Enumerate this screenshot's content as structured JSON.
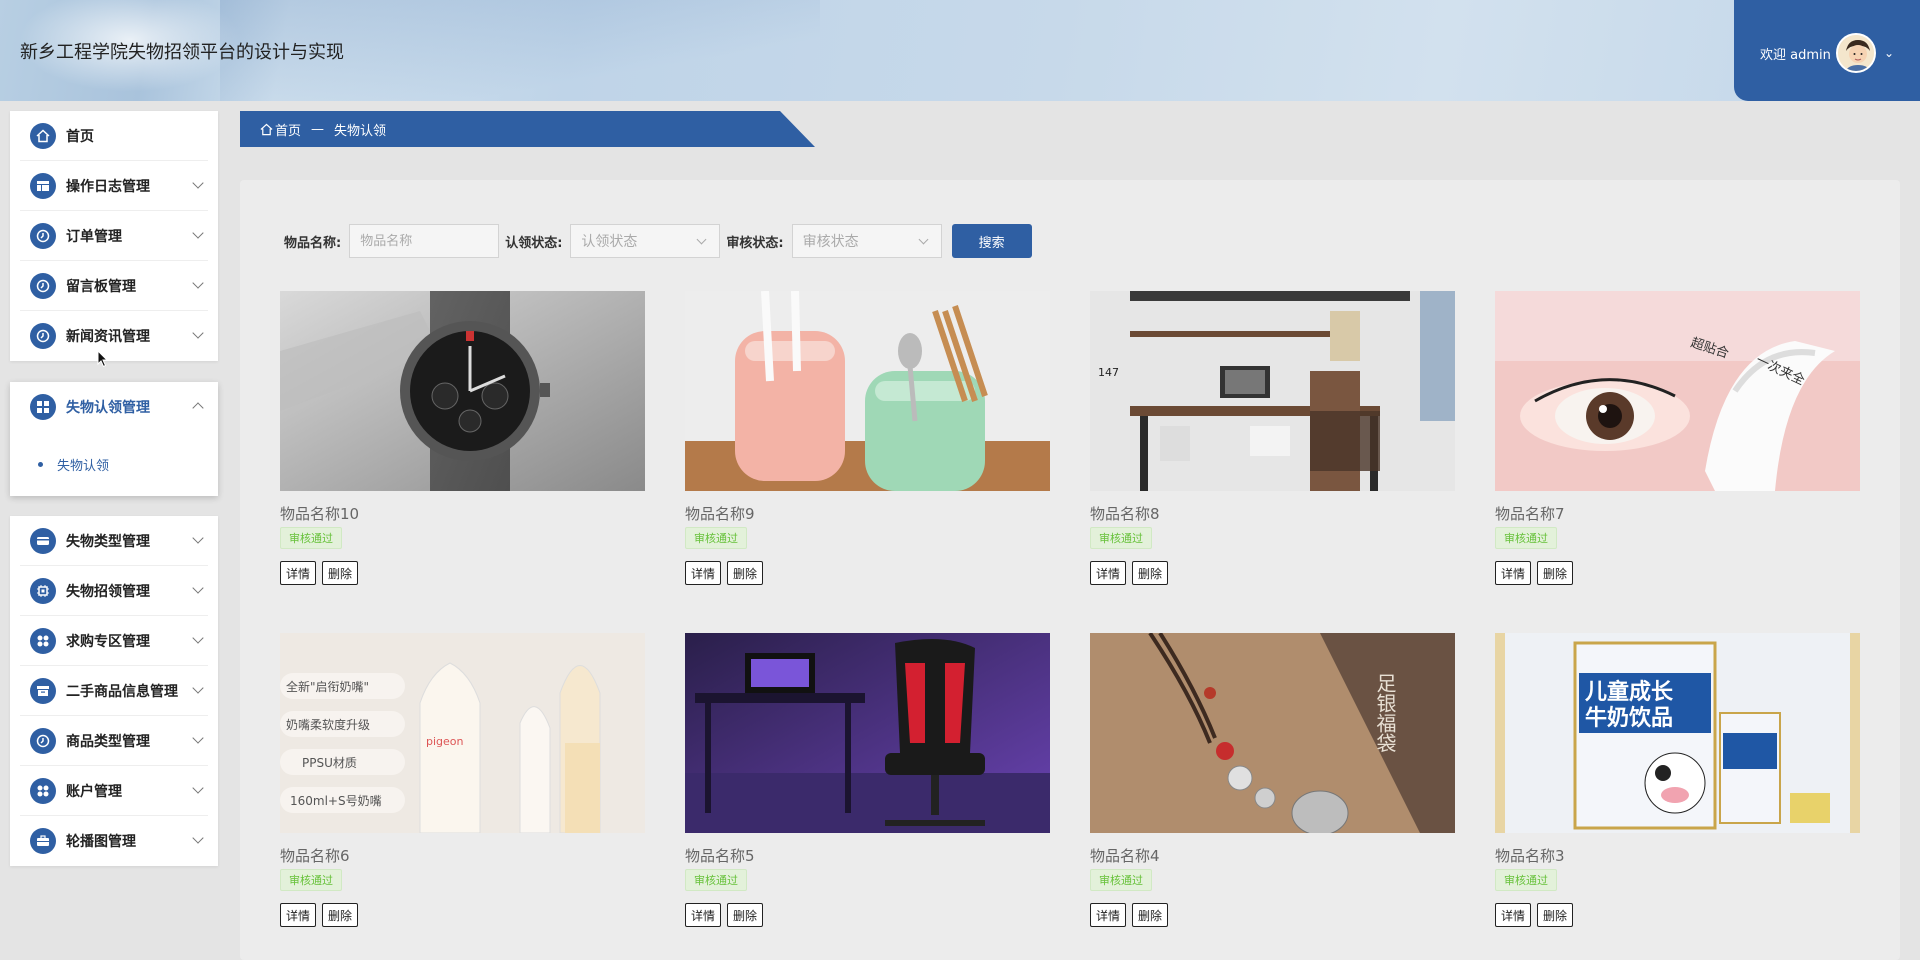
{
  "header": {
    "title": "新乡工程学院失物招领平台的设计与实现",
    "welcome": "欢迎 admin"
  },
  "sidebar": {
    "group1": [
      {
        "label": "首页",
        "icon": "home-icon"
      },
      {
        "label": "操作日志管理",
        "icon": "table-icon"
      },
      {
        "label": "订单管理",
        "icon": "clock-icon"
      },
      {
        "label": "留言板管理",
        "icon": "clock-icon"
      },
      {
        "label": "新闻资讯管理",
        "icon": "clock-icon"
      }
    ],
    "active_group": {
      "label": "失物认领管理",
      "icon": "grid-icon",
      "sub": "失物认领"
    },
    "group3": [
      {
        "label": "失物类型管理",
        "icon": "card-icon"
      },
      {
        "label": "失物招领管理",
        "icon": "chip-icon"
      },
      {
        "label": "求购专区管理",
        "icon": "apps-icon"
      },
      {
        "label": "二手商品信息管理",
        "icon": "box-icon"
      },
      {
        "label": "商品类型管理",
        "icon": "clock-icon"
      },
      {
        "label": "账户管理",
        "icon": "apps-icon"
      },
      {
        "label": "轮播图管理",
        "icon": "toolbox-icon"
      }
    ]
  },
  "breadcrumb": {
    "home": "首页",
    "sep": "—",
    "current": "失物认领"
  },
  "search": {
    "name_label": "物品名称:",
    "name_placeholder": "物品名称",
    "claim_label": "认领状态:",
    "claim_placeholder": "认领状态",
    "audit_label": "审核状态:",
    "audit_placeholder": "审核状态",
    "button": "搜索"
  },
  "items": [
    {
      "name": "物品名称10",
      "status": "审核通过",
      "detail": "详情",
      "delete": "删除",
      "image": "wristwatch"
    },
    {
      "name": "物品名称9",
      "status": "审核通过",
      "detail": "详情",
      "delete": "删除",
      "image": "utensil-holder"
    },
    {
      "name": "物品名称8",
      "status": "审核通过",
      "detail": "详情",
      "delete": "删除",
      "image": "desk"
    },
    {
      "name": "物品名称7",
      "status": "审核通过",
      "detail": "详情",
      "delete": "删除",
      "image": "eyelash-curler"
    },
    {
      "name": "物品名称6",
      "status": "审核通过",
      "detail": "详情",
      "delete": "删除",
      "image": "baby-bottles"
    },
    {
      "name": "物品名称5",
      "status": "审核通过",
      "detail": "详情",
      "delete": "删除",
      "image": "gaming-chair"
    },
    {
      "name": "物品名称4",
      "status": "审核通过",
      "detail": "详情",
      "delete": "删除",
      "image": "pendant"
    },
    {
      "name": "物品名称3",
      "status": "审核通过",
      "detail": "详情",
      "delete": "删除",
      "image": "milk-drink"
    }
  ],
  "image_text": {
    "desk_height": "147",
    "lash_a": "超贴合",
    "lash_b": "一次夹全",
    "bottle_1": "全新\"启衔奶嘴\"",
    "bottle_2": "奶嘴柔软度升级",
    "bottle_3": "PPSU材质",
    "bottle_4": "160ml+S号奶嘴",
    "bottle_brand": "pigeon",
    "pendant_chars": "足银福袋",
    "milk_1": "儿童成长",
    "milk_2": "牛奶饮品"
  },
  "colors": {
    "primary": "#2f5fa3",
    "success": "#67c23a"
  }
}
